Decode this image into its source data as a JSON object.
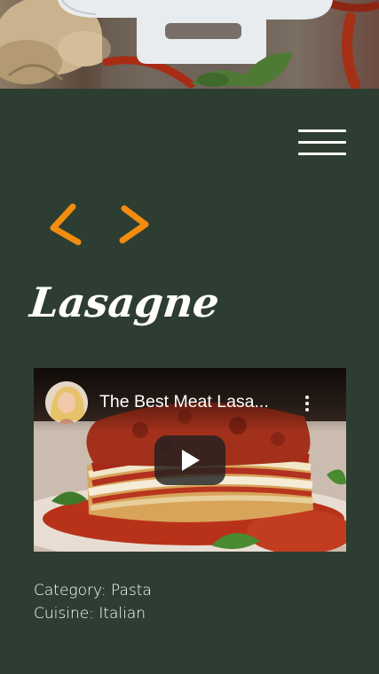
{
  "recipe": {
    "title": "Lasagne",
    "category_label": "Category:",
    "category_value": "Pasta",
    "cuisine_label": "Cuisine:",
    "cuisine_value": "Italian"
  },
  "nav": {
    "prev_label": "<",
    "next_label": ">",
    "prev_icon": "chevron-left-icon",
    "next_icon": "chevron-right-icon",
    "menu_icon": "hamburger-menu-icon"
  },
  "video": {
    "title": "The Best Meat Lasa...",
    "play_icon": "play-icon",
    "menu_icon": "more-vertical-icon"
  },
  "colors": {
    "background": "#2e3d31",
    "accent": "#f28c0f",
    "text": "#ffffff"
  }
}
